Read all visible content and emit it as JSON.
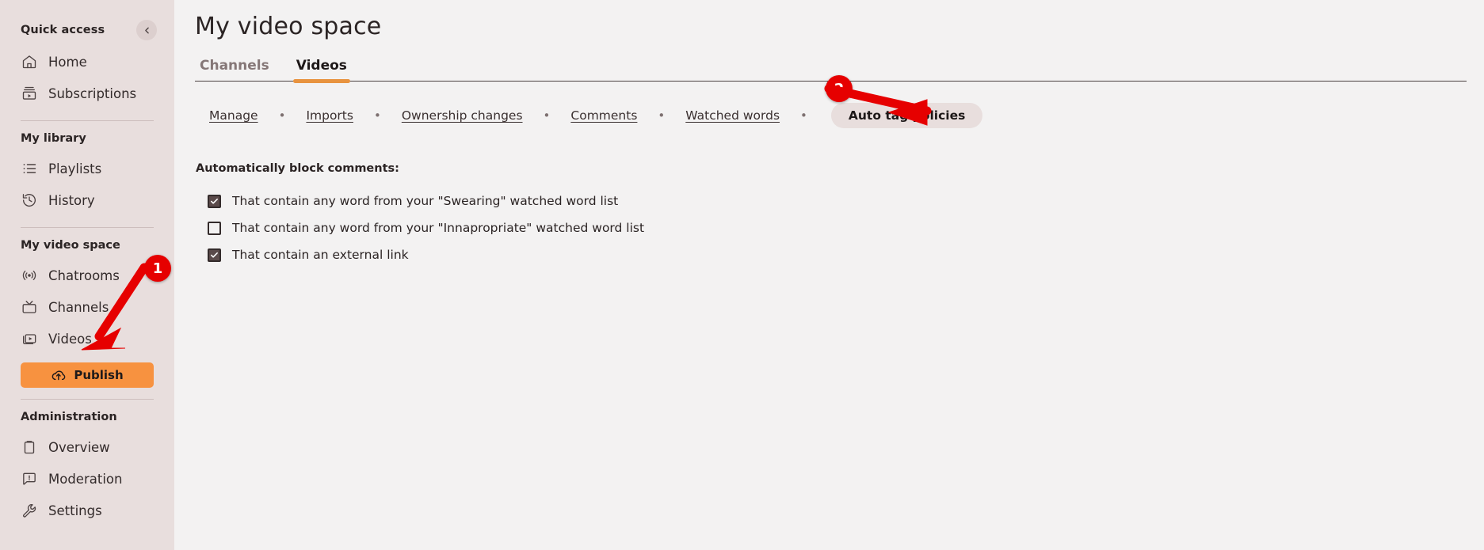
{
  "sidebar": {
    "quick_access": {
      "title": "Quick access",
      "collapse_icon": "chevron-left-icon",
      "items": [
        {
          "label": "Home",
          "icon": "home-icon"
        },
        {
          "label": "Subscriptions",
          "icon": "subscriptions-icon"
        }
      ]
    },
    "my_library": {
      "title": "My library",
      "items": [
        {
          "label": "Playlists",
          "icon": "playlist-icon"
        },
        {
          "label": "History",
          "icon": "history-icon"
        }
      ]
    },
    "my_video_space": {
      "title": "My video space",
      "items": [
        {
          "label": "Chatrooms",
          "icon": "broadcast-icon"
        },
        {
          "label": "Channels",
          "icon": "tv-icon"
        },
        {
          "label": "Videos",
          "icon": "video-icon"
        }
      ]
    },
    "publish": {
      "label": "Publish",
      "icon": "cloud-upload-icon",
      "color": "#f79240"
    },
    "administration": {
      "title": "Administration",
      "items": [
        {
          "label": "Overview",
          "icon": "clipboard-icon"
        },
        {
          "label": "Moderation",
          "icon": "comment-alert-icon"
        },
        {
          "label": "Settings",
          "icon": "wrench-icon"
        }
      ]
    }
  },
  "main": {
    "page_title": "My video space",
    "tabs": [
      {
        "label": "Channels",
        "active": false
      },
      {
        "label": "Videos",
        "active": true
      }
    ],
    "active_tab_color": "#e8933f",
    "subnav": {
      "separator": "•",
      "items": [
        {
          "label": "Manage",
          "type": "link"
        },
        {
          "label": "Imports",
          "type": "link"
        },
        {
          "label": "Ownership changes",
          "type": "link"
        },
        {
          "label": "Comments",
          "type": "link"
        },
        {
          "label": "Watched words",
          "type": "link"
        },
        {
          "label": "Auto tag policies",
          "type": "pill",
          "active": true
        }
      ]
    },
    "block_title": "Automatically block comments:",
    "checkboxes": [
      {
        "label": "That contain any word from your \"Swearing\" watched word list",
        "checked": true
      },
      {
        "label": "That contain any word from your \"Innapropriate\" watched word list",
        "checked": false
      },
      {
        "label": "That contain an external link",
        "checked": true
      }
    ]
  },
  "annotations": {
    "color": "#e60000",
    "markers": [
      {
        "id": "1",
        "label": "1",
        "points_at": "sidebar-item-videos"
      },
      {
        "id": "2",
        "label": "2",
        "points_at": "subnav-pill-auto-tag-policies"
      }
    ]
  }
}
